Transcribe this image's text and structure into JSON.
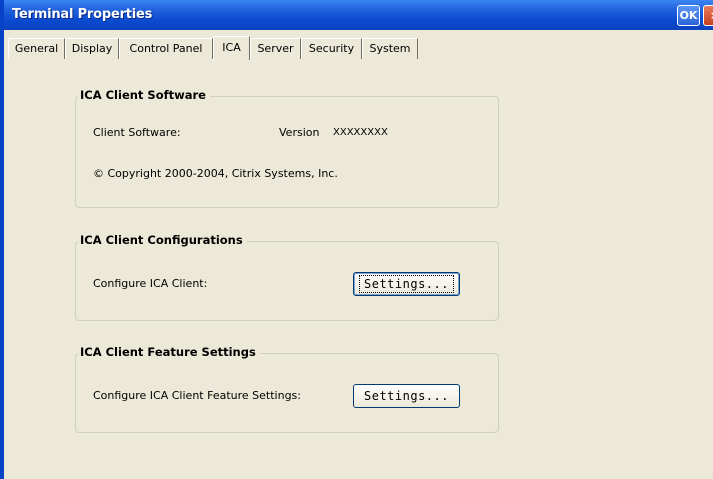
{
  "window": {
    "title": "Terminal Properties",
    "ok_label": "OK",
    "close_label": "×"
  },
  "tabs": [
    {
      "label": "General"
    },
    {
      "label": "Display"
    },
    {
      "label": "Control Panel"
    },
    {
      "label": "ICA",
      "active": true
    },
    {
      "label": "Server"
    },
    {
      "label": "Security"
    },
    {
      "label": "System"
    }
  ],
  "client_software": {
    "title": "ICA Client Software",
    "software_label": "Client Software:",
    "version_label": "Version",
    "version_value": "XXXXXXXX",
    "copyright": "© Copyright 2000-2004, Citrix Systems, Inc."
  },
  "client_config": {
    "title": "ICA Client Configurations",
    "configure_label": "Configure ICA Client:",
    "settings_label": "Settings..."
  },
  "feature_settings": {
    "title": "ICA Client Feature Settings",
    "configure_label": "Configure ICA Client Feature Settings:",
    "settings_label": "Settings..."
  },
  "colors": {
    "titlebar": "#0a49cf",
    "dialog_bg": "#ece9d8",
    "close_button": "#c7401f"
  }
}
